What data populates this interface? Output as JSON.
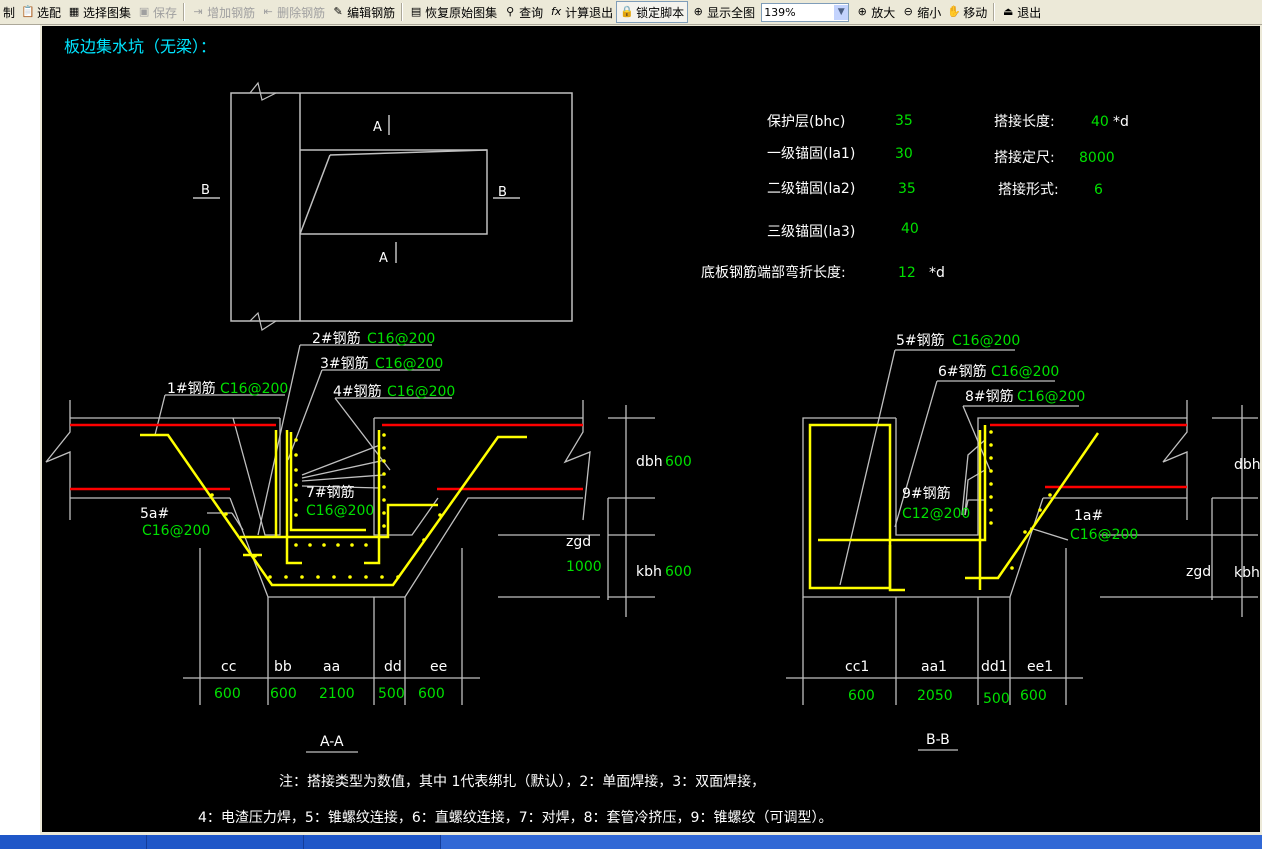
{
  "toolbar": {
    "items": [
      {
        "label": "制",
        "icon": "print-icon",
        "enabled": true
      },
      {
        "label": "选配",
        "icon": "paste-icon",
        "enabled": true
      },
      {
        "label": "选择图集",
        "icon": "select-atlas-icon",
        "enabled": true
      },
      {
        "label": "保存",
        "icon": "save-icon",
        "enabled": false
      },
      {
        "label": "增加钢筋",
        "icon": "add-rebar-icon",
        "enabled": false
      },
      {
        "label": "删除钢筋",
        "icon": "delete-rebar-icon",
        "enabled": false
      },
      {
        "label": "编辑钢筋",
        "icon": "edit-rebar-icon",
        "enabled": true
      },
      {
        "label": "恢复原始图集",
        "icon": "restore-icon",
        "enabled": true
      },
      {
        "label": "查询",
        "icon": "binoculars-icon",
        "enabled": true
      },
      {
        "label": "计算退出",
        "icon": "fx-icon",
        "enabled": true
      },
      {
        "label": "锁定脚本",
        "icon": "lock-icon",
        "enabled": true
      },
      {
        "label": "显示全图",
        "icon": "zoom-all-icon",
        "enabled": true
      },
      {
        "label": "放大",
        "icon": "zoom-in-icon",
        "enabled": true
      },
      {
        "label": "缩小",
        "icon": "zoom-out-icon",
        "enabled": true
      },
      {
        "label": "移动",
        "icon": "pan-icon",
        "enabled": true
      },
      {
        "label": "退出",
        "icon": "exit-icon",
        "enabled": true
      }
    ],
    "zoom_value": "139%"
  },
  "drawing": {
    "title": "板边集水坑（无梁）：",
    "plan": {
      "label_a_top": "A",
      "label_a_bottom": "A",
      "label_b_left": "B",
      "label_b_right": "B"
    },
    "params": {
      "bhc_label": "保护层(bhc)",
      "bhc_value": "35",
      "la1_label": "一级锚固(la1)",
      "la1_value": "30",
      "la2_label": "二级锚固(la2)",
      "la2_value": "35",
      "la3_label": "三级锚固(la3)",
      "la3_value": "40",
      "lap_len_label": "搭接长度:",
      "lap_len_value": "40",
      "lap_len_unit": "*d",
      "lap_fix_label": "搭接定尺:",
      "lap_fix_value": "8000",
      "lap_type_label": "搭接形式:",
      "lap_type_value": "6",
      "bend_label": "底板钢筋端部弯折长度:",
      "bend_value": "12",
      "bend_unit": "*d"
    },
    "section_aa": {
      "title": "A-A",
      "r1_label": "1#钢筋",
      "r1_value": "C16@200",
      "r2_label": "2#钢筋",
      "r2_value": "C16@200",
      "r3_label": "3#钢筋",
      "r3_value": "C16@200",
      "r4_label": "4#钢筋",
      "r4_value": "C16@200",
      "r5_label": "5a#",
      "r5_value": "C16@200",
      "r7_label": "7#钢筋",
      "r7_value": "C16@200",
      "dbh_label": "dbh",
      "dbh_value": "600",
      "kbh_label": "kbh",
      "kbh_value": "600",
      "zgd_label": "zgd",
      "zgd_value": "1000",
      "dims": [
        {
          "label": "cc",
          "value": "600"
        },
        {
          "label": "bb",
          "value": "600"
        },
        {
          "label": "aa",
          "value": "2100"
        },
        {
          "label": "dd",
          "value": "500"
        },
        {
          "label": "ee",
          "value": "600"
        }
      ]
    },
    "section_bb": {
      "title": "B-B",
      "r5_label": "5#钢筋",
      "r5_value": "C16@200",
      "r6_label": "6#钢筋",
      "r6_value": "C16@200",
      "r8_label": "8#钢筋",
      "r8_value": "C16@200",
      "r9_label": "9#钢筋",
      "r9_value": "C12@200",
      "r1a_label": "1a#",
      "r1a_value": "C16@200",
      "dbh_label": "dbh",
      "kbh_label": "kbh",
      "zgd_label": "zgd",
      "dims": [
        {
          "label": "cc1",
          "value": "600"
        },
        {
          "label": "aa1",
          "value": "2050"
        },
        {
          "label": "dd1",
          "value": "500"
        },
        {
          "label": "ee1",
          "value": "600"
        }
      ]
    },
    "note_line1": "注：搭接类型为数值，其中 1代表绑扎（默认），2：单面焊接，3：双面焊接，",
    "note_line2": "4：电渣压力焊，5：锥螺纹连接，6：直螺纹连接，7：对焊，8：套管冷挤压，9：锥螺纹（可调型）。"
  },
  "colors": {
    "background": "#000000",
    "title": "#00e5ff",
    "value": "#00e000",
    "text": "#ffffff",
    "rebar_main": "#ffff00",
    "rebar_top": "#ff0000"
  }
}
